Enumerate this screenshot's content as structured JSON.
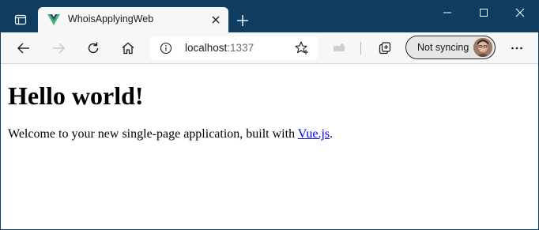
{
  "tab": {
    "title": "WhoisApplyingWeb",
    "favicon": "vue-logo-icon"
  },
  "address": {
    "host": "localhost",
    "port": ":1337"
  },
  "profile": {
    "label": "Not syncing"
  },
  "page": {
    "heading": "Hello world!",
    "intro_before": "Welcome to your new single-page application, built with ",
    "link_text": "Vue.js",
    "intro_after": "."
  },
  "colors": {
    "titlebar": "#0f3d62",
    "toolbar": "#f7f7f7",
    "link": "#0000ee",
    "vue_green": "#41b883",
    "vue_dark": "#35495e"
  }
}
